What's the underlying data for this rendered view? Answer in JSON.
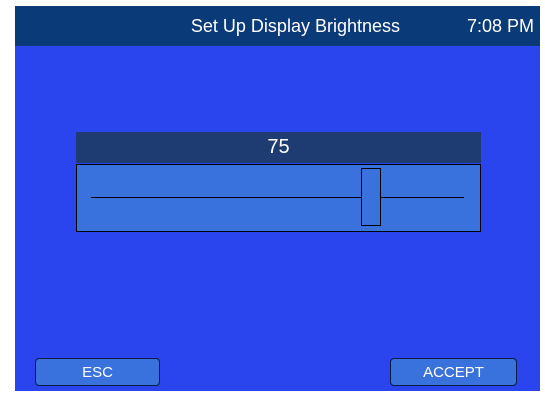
{
  "header": {
    "title": "Set Up Display Brightness",
    "time": "7:08 PM"
  },
  "brightness": {
    "value_label": "75",
    "value": 75,
    "min": 0,
    "max": 100
  },
  "buttons": {
    "esc_label": "ESC",
    "accept_label": "ACCEPT"
  },
  "colors": {
    "header_bg": "#0a3a78",
    "panel_bg": "#2a44ee",
    "control_bg": "#3a72dd",
    "value_strip_bg": "#1e3b72"
  }
}
